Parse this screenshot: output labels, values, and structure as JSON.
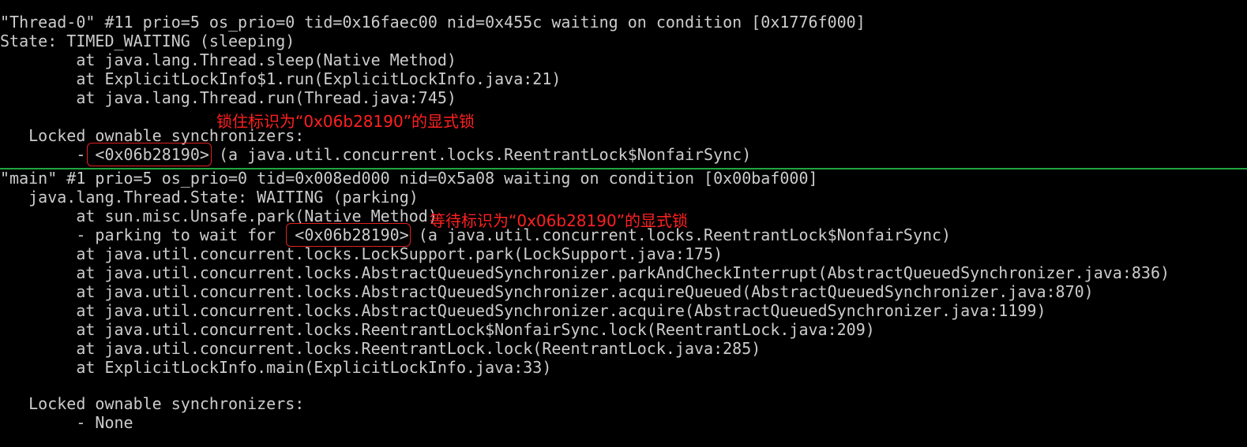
{
  "terminal": {
    "lines": [
      "\"Thread-0\" #11 prio=5 os_prio=0 tid=0x16faec00 nid=0x455c waiting on condition [0x1776f000]",
      "State: TIMED_WAITING (sleeping)",
      "        at java.lang.Thread.sleep(Native Method)",
      "        at ExplicitLockInfo$1.run(ExplicitLockInfo.java:21)",
      "        at java.lang.Thread.run(Thread.java:745)",
      "",
      "   Locked ownable synchronizers:",
      "        - <0x06b28190> (a java.util.concurrent.locks.ReentrantLock$NonfairSync)",
      "\"main\" #1 prio=5 os_prio=0 tid=0x008ed000 nid=0x5a08 waiting on condition [0x00baf000]",
      "   java.lang.Thread.State: WAITING (parking)",
      "        at sun.misc.Unsafe.park(Native Method)",
      "        - parking to wait for  <0x06b28190> (a java.util.concurrent.locks.ReentrantLock$NonfairSync)",
      "        at java.util.concurrent.locks.LockSupport.park(LockSupport.java:175)",
      "        at java.util.concurrent.locks.AbstractQueuedSynchronizer.parkAndCheckInterrupt(AbstractQueuedSynchronizer.java:836)",
      "        at java.util.concurrent.locks.AbstractQueuedSynchronizer.acquireQueued(AbstractQueuedSynchronizer.java:870)",
      "        at java.util.concurrent.locks.AbstractQueuedSynchronizer.acquire(AbstractQueuedSynchronizer.java:1199)",
      "        at java.util.concurrent.locks.ReentrantLock$NonfairSync.lock(ReentrantLock.java:209)",
      "        at java.util.concurrent.locks.ReentrantLock.lock(ReentrantLock.java:285)",
      "        at ExplicitLockInfo.main(ExplicitLockInfo.java:33)",
      "",
      "   Locked ownable synchronizers:",
      "        - None"
    ]
  },
  "annotations": {
    "locked_note": "锁住标识为“0x06b28190”的显式锁",
    "waiting_note": "等待标识为“0x06b28190”的显式锁"
  },
  "colors": {
    "background": "#000000",
    "text": "#cccccc",
    "annotation": "#ff2020",
    "divider": "#1fa640"
  }
}
